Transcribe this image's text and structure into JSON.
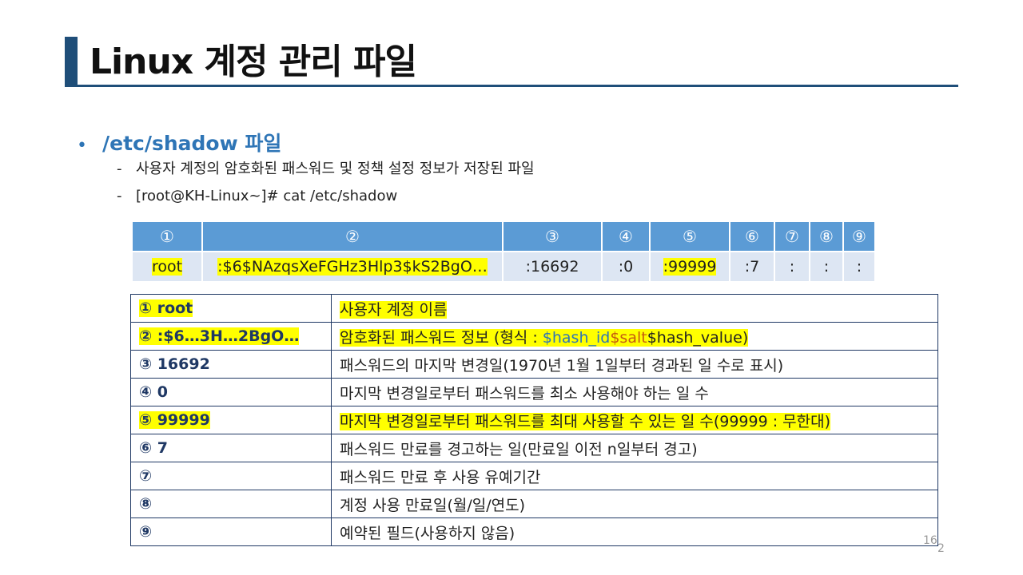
{
  "title": "Linux 계정 관리 파일",
  "bullet": {
    "heading": "/etc/shadow 파일",
    "subitems": [
      "사용자 계정의 암호화된 패스워드 및 정책 설정 정보가 저장된 파일",
      "[root@KH-Linux~]#  cat /etc/shadow"
    ]
  },
  "shadow_table": {
    "headers": [
      "①",
      "②",
      "③",
      "④",
      "⑤",
      "⑥",
      "⑦",
      "⑧",
      "⑨"
    ],
    "values": [
      "root",
      ":$6$NAzqsXeFGHz3Hlp3$kS2BgO…",
      ":16692",
      ":0",
      ":99999",
      ":7",
      ":",
      ":",
      ":"
    ]
  },
  "desc_table": {
    "rows": [
      {
        "key": "① root",
        "desc": "사용자 계정 이름"
      },
      {
        "key": "② :$6…3H…2BgO…",
        "desc_prefix": "암호화된 패스워드 정보 (형식 : ",
        "hash_id": "$hash_id",
        "salt": "$salt",
        "hash_value": "$hash_value",
        "desc_suffix": ")"
      },
      {
        "key": "③ 16692",
        "desc": "패스워드의 마지막 변경일(1970년 1월 1일부터 경과된 일 수로 표시)"
      },
      {
        "key": "④ 0",
        "desc": "마지막 변경일로부터 패스워드를 최소 사용해야 하는 일 수"
      },
      {
        "key": "⑤ 99999",
        "desc": "마지막 변경일로부터 패스워드를 최대 사용할 수 있는 일 수(99999 : 무한대)"
      },
      {
        "key": "⑥ 7",
        "desc": "패스워드 만료를 경고하는 일(만료일 이전 n일부터 경고)"
      },
      {
        "key": "⑦",
        "desc": "패스워드 만료 후 사용 유예기간"
      },
      {
        "key": "⑧",
        "desc": "계정 사용 만료일(월/일/연도)"
      },
      {
        "key": "⑨",
        "desc": "예약된 필드(사용하지 않음)"
      }
    ]
  },
  "page_number": "16",
  "page_number_suffix": "2"
}
